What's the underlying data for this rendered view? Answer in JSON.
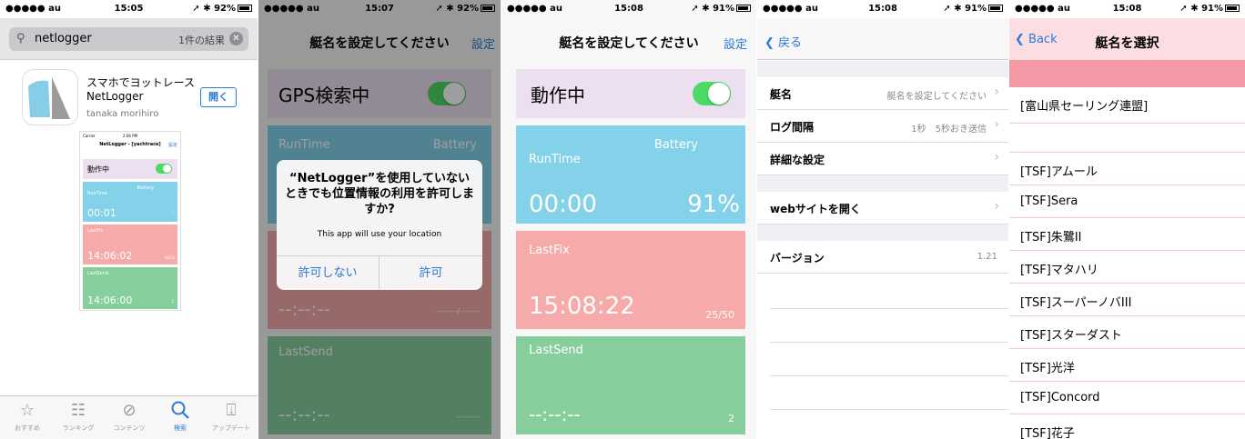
{
  "status_bars": [
    {
      "carrier": "●●●●● au",
      "time": "15:05",
      "battery": "92%"
    },
    {
      "carrier": "●●●●● au",
      "time": "15:07",
      "battery": "92%"
    },
    {
      "carrier": "●●●●● au",
      "time": "15:08",
      "battery": "91%"
    },
    {
      "carrier": "●●●●● au",
      "time": "15:08",
      "battery": "91%"
    },
    {
      "carrier": "●●●●● au",
      "time": "15:08",
      "battery": "91%"
    }
  ],
  "appstore": {
    "search_value": "netlogger",
    "result_count": "1件の結果",
    "app_name": "スマホでヨットレース NetLogger",
    "developer": "tanaka morihiro",
    "open_label": "開く",
    "preview": {
      "carrier": "Carrier",
      "time": "2:06 PM",
      "title": "NetLogger - [yachtrace]",
      "settings": "設定",
      "status": "動作中",
      "runtime_label": "RunTime",
      "battery_label": "Battery",
      "runtime": "00:01",
      "battery": "-",
      "lastfix_label": "LastFix",
      "lastfix": "14:06:02",
      "lastfix_count": "16/16",
      "lastsend_label": "LastSend",
      "lastsend": "14:06:00",
      "lastsend_count": "2"
    },
    "tabs": [
      {
        "label": "おすすめ",
        "icon": "star-icon"
      },
      {
        "label": "ランキング",
        "icon": "list-icon"
      },
      {
        "label": "コンテンツ",
        "icon": "compass-icon"
      },
      {
        "label": "検索",
        "icon": "search-icon"
      },
      {
        "label": "アップデート",
        "icon": "download-icon"
      }
    ]
  },
  "screen2": {
    "title": "艇名を設定してください",
    "settings": "設定",
    "status": "GPS検索中",
    "runtime_label": "RunTime",
    "battery_label": "Battery",
    "lastfix_time": "--:--:--",
    "lastfix_count": "-------/-------",
    "lastsend_label": "LastSend",
    "lastsend_time": "--:--:--",
    "lastsend_count": "--------",
    "alert": {
      "title": "“NetLogger”を使用していないときでも位置情報の利用を許可しますか?",
      "message": "This app will use your location",
      "deny": "許可しない",
      "allow": "許可"
    }
  },
  "screen3": {
    "title": "艇名を設定してください",
    "settings": "設定",
    "status": "動作中",
    "runtime_label": "RunTime",
    "battery_label": "Battery",
    "runtime": "00:00",
    "battery": "91%",
    "lastfix_label": "LastFix",
    "lastfix": "15:08:22",
    "lastfix_count": "25/50",
    "lastsend_label": "LastSend",
    "lastsend": "--:--:--",
    "lastsend_count": "2"
  },
  "settings": {
    "back": "戻る",
    "rows": [
      {
        "label": "艇名",
        "value": "艇名を設定してください"
      },
      {
        "label": "ログ間隔",
        "value": "1秒　5秒おき送信"
      },
      {
        "label": "詳細な設定",
        "value": ""
      },
      {
        "label": "webサイトを開く",
        "value": ""
      },
      {
        "label": "バージョン",
        "value": "1.21"
      }
    ]
  },
  "boats": {
    "back": "Back",
    "title": "艇名を選択",
    "items": [
      "[富山県セーリング連盟]",
      "",
      "[TSF]アムール",
      "[TSF]Sera",
      "[TSF]朱鷺II",
      "[TSF]マタハリ",
      "[TSF]スーパーノバIII",
      "[TSF]スターダスト",
      "[TSF]光洋",
      "[TSF]Concord",
      "[TSF]花子"
    ]
  },
  "colors": {
    "status_bg": "#ecdff0",
    "runtime_bg": "#84d2ea",
    "lastfix_bg": "#f6aaaa",
    "lastsend_bg": "#86cf9c",
    "accent": "#2b79d8"
  }
}
